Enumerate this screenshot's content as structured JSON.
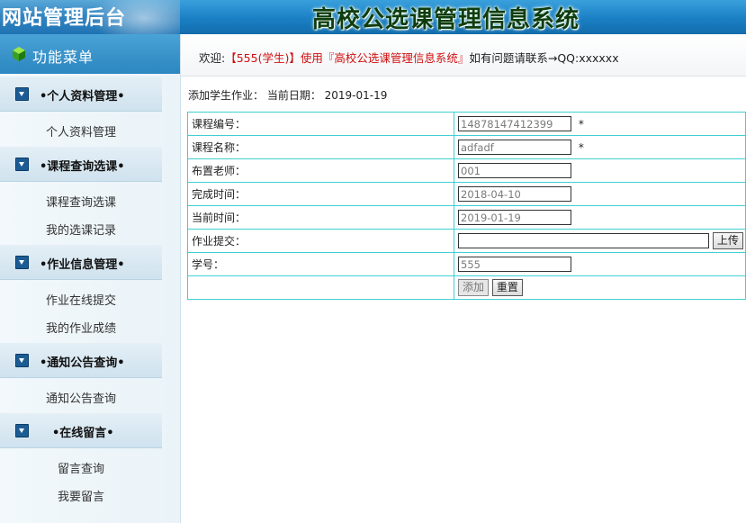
{
  "header": {
    "admin_title": "网站管理后台",
    "system_title": "高校公选课管理信息系统"
  },
  "sidebar": {
    "menu_title": "功能菜单",
    "groups": [
      {
        "title": "•个人资料管理•",
        "items": [
          "个人资料管理"
        ]
      },
      {
        "title": "•课程查询选课•",
        "items": [
          "课程查询选课",
          "我的选课记录"
        ]
      },
      {
        "title": "•作业信息管理•",
        "items": [
          "作业在线提交",
          "我的作业成绩"
        ]
      },
      {
        "title": "•通知公告查询•",
        "items": [
          "通知公告查询"
        ]
      },
      {
        "title": "•在线留言•",
        "items": [
          "留言查询",
          "我要留言"
        ]
      }
    ]
  },
  "welcome": {
    "prefix": "欢迎:",
    "user": "【555(学生)】使用『高校公选课管理信息系统』",
    "suffix": "如有问题请联系→QQ:xxxxxx"
  },
  "breadcrumb": "添加学生作业： 当前日期： 2019-01-19",
  "form": {
    "rows": [
      {
        "label": "课程编号：",
        "value": "14878147412399",
        "required": "*"
      },
      {
        "label": "课程名称：",
        "value": "adfadf",
        "required": "*"
      },
      {
        "label": "布置老师：",
        "value": "001"
      },
      {
        "label": "完成时间：",
        "value": "2018-04-10"
      },
      {
        "label": "当前时间：",
        "value": "2019-01-19"
      },
      {
        "label": "作业提交：",
        "value": ""
      },
      {
        "label": "学号：",
        "value": "555"
      }
    ],
    "upload_label": "上传",
    "add_label": "添加",
    "reset_label": "重置"
  }
}
